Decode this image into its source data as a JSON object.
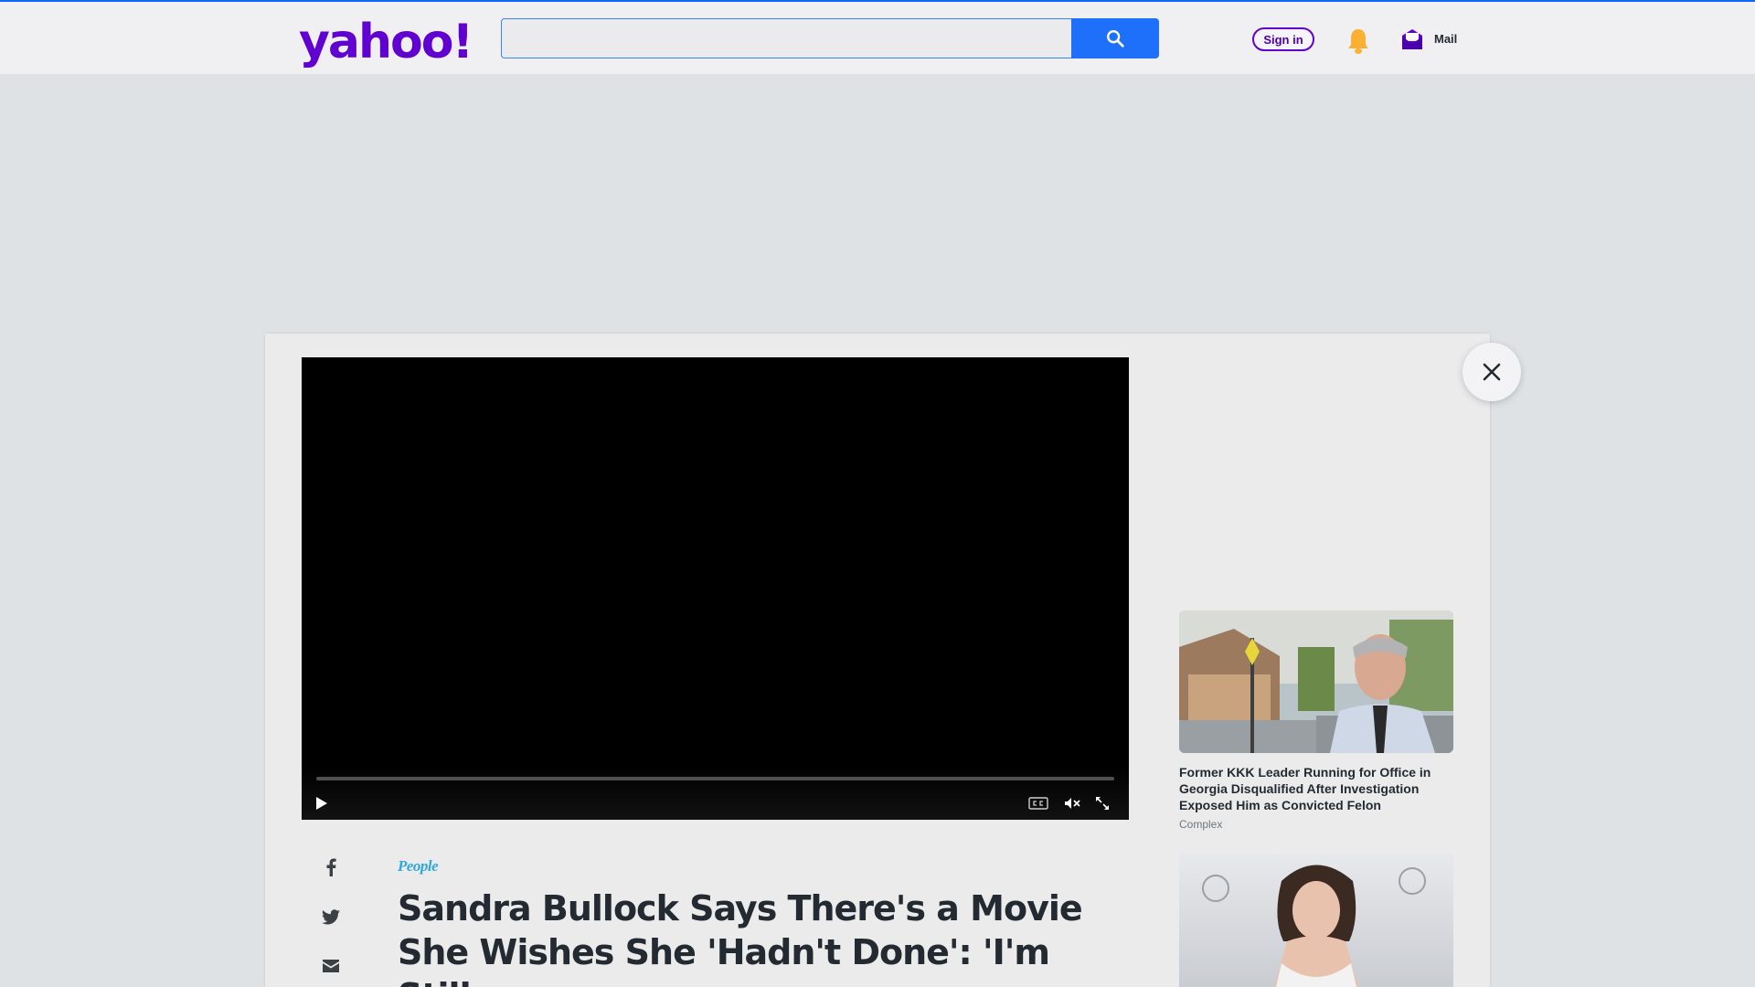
{
  "header": {
    "logo": "yahoo!",
    "search": {
      "value": "",
      "placeholder": ""
    },
    "sign_in_label": "Sign in",
    "mail_label": "Mail",
    "icons": [
      "search-icon",
      "bell-icon",
      "mail-icon"
    ]
  },
  "video": {
    "progress": 0,
    "controls": [
      "play-icon",
      "closed-captions-icon",
      "mute-icon",
      "fullscreen-icon"
    ]
  },
  "article": {
    "source": "People",
    "headline": "Sandra Bullock Says There's a Movie She Wishes She 'Hadn't Done': 'I'm Still",
    "share_icons": [
      "facebook-icon",
      "twitter-icon",
      "email-icon"
    ]
  },
  "related": [
    {
      "title": "Former KKK Leader Running for Office in Georgia Disqualified After Investigation Exposed Him as Convicted Felon",
      "source": "Complex"
    },
    {
      "title": "",
      "source": ""
    }
  ],
  "colors": {
    "brand": "#6001d2",
    "search_button": "#1e6ffa",
    "source_blue": "#2ea8e0",
    "bell": "#fbb034"
  }
}
